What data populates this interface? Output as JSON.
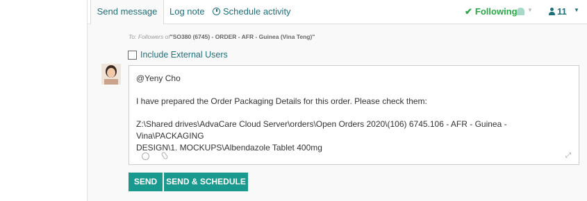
{
  "tabs": {
    "send_message": "Send message",
    "log_note": "Log note",
    "schedule_activity": "Schedule activity"
  },
  "following": {
    "label": "Following",
    "followers_count": "11"
  },
  "recipients": {
    "prefix": "To:",
    "followers_of": "Followers of",
    "record": "\"SO380 (6745) - ORDER - AFR - Guinea (Vina Teng)\""
  },
  "include_external": {
    "label": "Include External Users",
    "checked": false
  },
  "message": {
    "mention": "@Yeny Cho",
    "line1": "I have prepared the Order Packaging Details for this order.  Please check them:",
    "path_line1": "Z:\\Shared drives\\AdvaCare Cloud Server\\orders\\Open Orders 2020\\(106) 6745.106 - AFR - Guinea - Vina\\PACKAGING",
    "path_line2": "DESIGN\\1. MOCKUPS\\Albendazole Tablet 400mg"
  },
  "icons": {
    "check": "check-icon",
    "bell": "bell-icon",
    "person": "person-icon",
    "clock": "clock-icon",
    "emoji": "emoji-icon",
    "attach": "paperclip-icon",
    "expand": "expand-icon"
  },
  "buttons": {
    "send": "SEND",
    "send_schedule": "SEND & SCHEDULE"
  },
  "colors": {
    "accent": "#1f6f7a",
    "primary_button": "#1a9a8f",
    "following": "#28a745"
  }
}
